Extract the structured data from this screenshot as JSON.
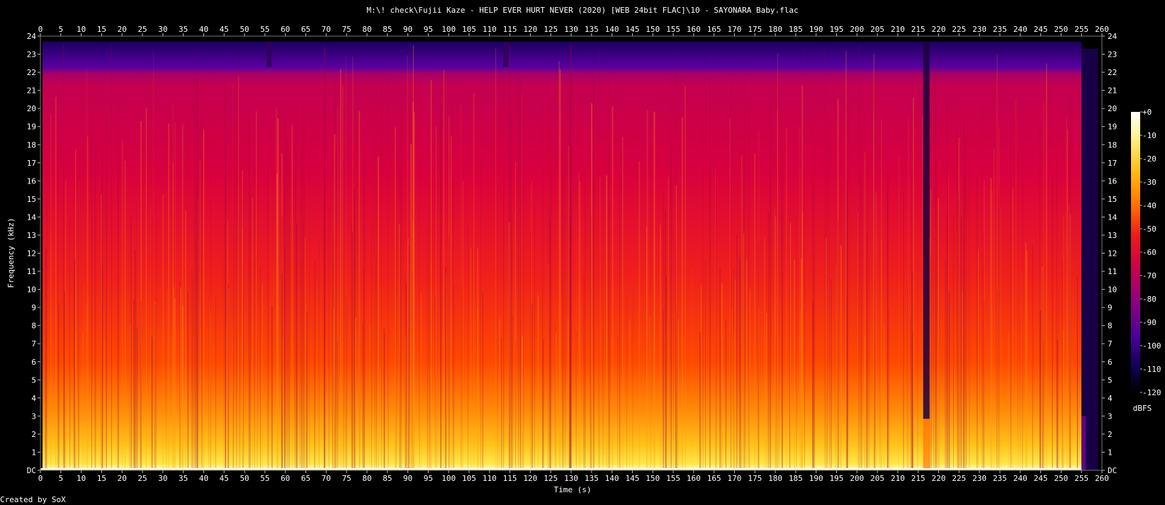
{
  "page": {
    "title": "M:\\! check\\Fujii Kaze - HELP EVER HURT NEVER (2020) [WEB 24bit FLAC]\\10 - SAYONARA Baby.flac",
    "credit": "Created by SoX"
  },
  "chart_data": {
    "type": "heatmap",
    "title": "M:\\! check\\Fujii Kaze - HELP EVER HURT NEVER (2020) [WEB 24bit FLAC]\\10 - SAYONARA Baby.flac",
    "xlabel": "Time (s)",
    "ylabel": "Frequency (kHz)",
    "xlim": [
      0,
      260
    ],
    "ylim": [
      0,
      24
    ],
    "x_ticks": [
      "0",
      "5",
      "10",
      "15",
      "20",
      "25",
      "30",
      "35",
      "40",
      "45",
      "50",
      "55",
      "60",
      "65",
      "70",
      "75",
      "80",
      "85",
      "90",
      "95",
      "100",
      "105",
      "110",
      "115",
      "120",
      "125",
      "130",
      "135",
      "140",
      "145",
      "150",
      "155",
      "160",
      "165",
      "170",
      "175",
      "180",
      "185",
      "190",
      "195",
      "200",
      "205",
      "210",
      "215",
      "220",
      "225",
      "230",
      "235",
      "240",
      "245",
      "250",
      "255",
      "260"
    ],
    "y_ticks": [
      "DC",
      "1",
      "2",
      "3",
      "4",
      "5",
      "6",
      "7",
      "8",
      "9",
      "10",
      "11",
      "12",
      "13",
      "14",
      "15",
      "16",
      "17",
      "18",
      "19",
      "20",
      "21",
      "22",
      "23",
      "24"
    ],
    "colorbar": {
      "label": "dBFS",
      "ticks": [
        "+0",
        "-10",
        "-20",
        "-30",
        "-40",
        "-50",
        "-60",
        "-70",
        "-80",
        "-90",
        "-100",
        "-110",
        "-120"
      ],
      "range": [
        -120,
        0
      ]
    },
    "content_cutoff_khz": 22.6,
    "track_end_s": 255,
    "dropouts_s": [
      56,
      114,
      217
    ],
    "colors": {
      "background": "#000000",
      "lowband": "#ffd400",
      "midband": "#ff3a00",
      "highband": "#d0004a",
      "top": "#4a0090"
    }
  }
}
